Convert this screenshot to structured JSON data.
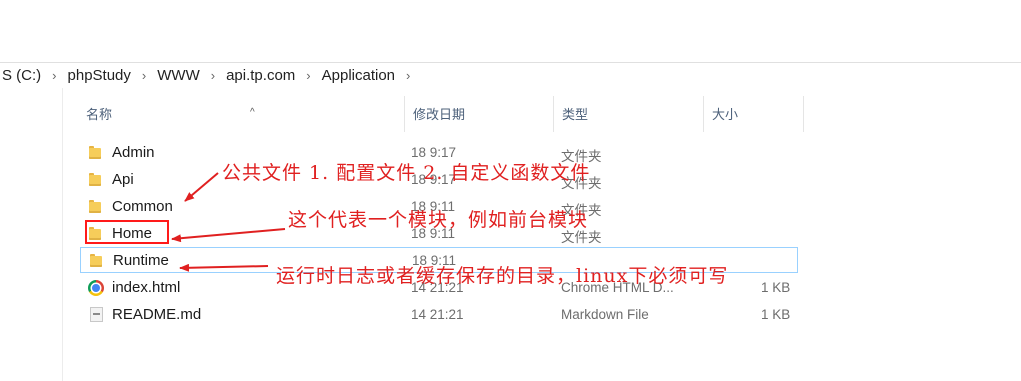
{
  "breadcrumb": {
    "items": [
      "S (C:)",
      "phpStudy",
      "WWW",
      "api.tp.com",
      "Application"
    ],
    "separator": "›"
  },
  "columns": {
    "name": "名称",
    "date": "修改日期",
    "type": "类型",
    "size": "大小"
  },
  "files": [
    {
      "name": "Admin",
      "date": "18 9:17",
      "type": "文件夹",
      "size": "",
      "icon": "folder-icon"
    },
    {
      "name": "Api",
      "date": "18 9:17",
      "type": "文件夹",
      "size": "",
      "icon": "folder-icon"
    },
    {
      "name": "Common",
      "date": "18 9:11",
      "type": "文件夹",
      "size": "",
      "icon": "folder-icon"
    },
    {
      "name": "Home",
      "date": "18 9:11",
      "type": "文件夹",
      "size": "",
      "icon": "folder-icon"
    },
    {
      "name": "Runtime",
      "date": "18 9:11",
      "type": "",
      "size": "",
      "icon": "folder-icon"
    },
    {
      "name": "index.html",
      "date": "14 21:21",
      "type": "Chrome HTML D...",
      "size": "1 KB",
      "icon": "chrome-icon"
    },
    {
      "name": "README.md",
      "date": "14 21:21",
      "type": "Markdown File",
      "size": "1 KB",
      "icon": "markdown-file-icon"
    }
  ],
  "annotations": {
    "common": "公共文件 1. 配置文件 2. 自定义函数文件",
    "home": "这个代表一个模块，例如前台模块",
    "runtime": "运行时日志或者缓存保存的目录，linux下必须可写"
  },
  "colors": {
    "annotation": "#e02020",
    "folder": "#f6cd5a",
    "header_text": "#4c607a"
  }
}
